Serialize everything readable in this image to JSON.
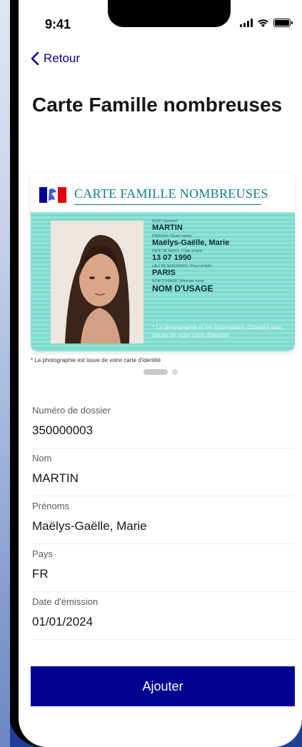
{
  "status_bar": {
    "time": "9:41"
  },
  "nav": {
    "back_label": "Retour"
  },
  "page": {
    "title": "Carte Famille nombreuses"
  },
  "card": {
    "title": "CARTE FAMILLE NOMBREUSES",
    "fields": [
      {
        "label": "NOM / Surname",
        "value": "MARTIN"
      },
      {
        "label": "PRÉNOM / Given names",
        "value": "Maëlys-Gaëlle, Marie"
      },
      {
        "label": "DATE DE NAISS. / Date of birth",
        "value": "13 07 1990"
      },
      {
        "label": "LIEU DE NAISSANCE / Place of birth",
        "value": "PARIS"
      },
      {
        "label": "NOM D'USAGE / Alternate name",
        "value": "NOM D'USAGE"
      }
    ],
    "note": "* La photographie et les informations d'identité sont issues de votre carte d'identité"
  },
  "photo_note": "* La photographie est issue de votre carte d'identité",
  "details": [
    {
      "label": "Numéro de dossier",
      "value": "350000003"
    },
    {
      "label": "Nom",
      "value": "MARTIN"
    },
    {
      "label": "Prénoms",
      "value": "Maëlys-Gaëlle, Marie"
    },
    {
      "label": "Pays",
      "value": "FR"
    },
    {
      "label": "Date d'émission",
      "value": "01/01/2024"
    }
  ],
  "actions": {
    "add_label": "Ajouter"
  },
  "colors": {
    "primary": "#000091",
    "card_teal": "#8fe3d6",
    "card_title": "#0f7c86"
  }
}
